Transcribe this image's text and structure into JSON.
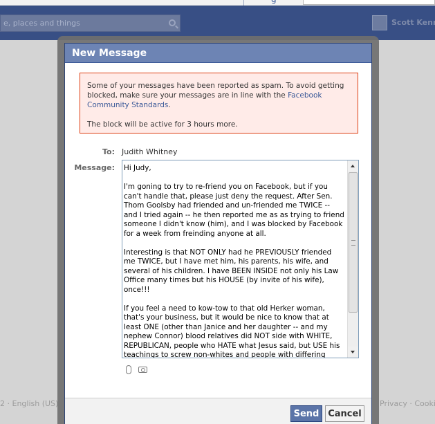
{
  "background": {
    "top_fragment": "g",
    "search_placeholder": "e, places and things",
    "user_name": "Scott Kenn",
    "footer_left": "2 · English (US)",
    "footer_right": "Privacy · Cookies"
  },
  "dialog": {
    "title": "New Message",
    "warning": {
      "text": "Some of your messages have been reported as spam. To avoid getting blocked, make sure your messages are in line with the ",
      "link": "Facebook Community Standards",
      "after_link": ".",
      "block_notice": "The block will be active for 3 hours more."
    },
    "to_label": "To:",
    "to_value": "Judith Whitney",
    "message_label": "Message:",
    "message_body": "Hi Judy,\n\nI'm goning to try to re-friend you on Facebook, but if you can't handle that, please just deny the request. After Sen. Thom Goolsby had friended and un-friended me TWICE -- and I tried again -- he then reported me as as trying to friend someone I didn't know (him), and I was blocked by Facebook for a week from freinding anyone at all.\n\nInteresting is that NOT ONLY had he PREVIOUSLY friended me TWICE, but I have met him, his parents, his wife, and several of his children. I have BEEN INSIDE not only his Law Office many times but his HOUSE (by invite of his wife), once!!!\n\nIf you feel a need to kow-tow to that old Herker woman, that's your business, but it would be nice to know that at least ONE (other than Janice and her daughter -- and my nephew Connor) blood relatives did NOT side with WHITE, REPUBLICAN, people who HATE what Jesus said, but USE his teachings to screw non-whites and people with differing opinions or \"live-styles\".",
    "send_label": "Send",
    "cancel_label": "Cancel"
  },
  "colors": {
    "title_bar": "#6d84b4",
    "warning_bg": "#ffebe8",
    "warning_border": "#dd3c10",
    "link": "#3b5998",
    "send_button": "#5b74a8"
  }
}
